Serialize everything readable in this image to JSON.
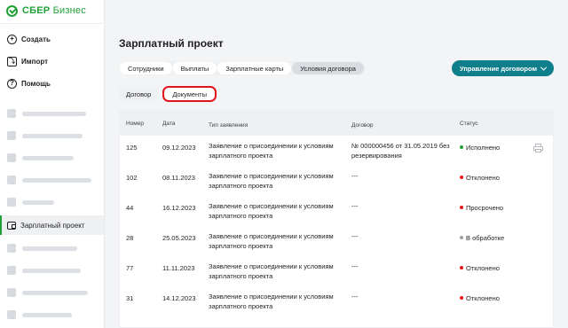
{
  "logo": {
    "brand": "СБЕР",
    "product": "Бизнес"
  },
  "sidebar": {
    "main_items": [
      {
        "label": "Создать",
        "icon": "plus-circle-icon"
      },
      {
        "label": "Импорт",
        "icon": "import-icon"
      },
      {
        "label": "Помощь",
        "icon": "help-circle-icon"
      }
    ],
    "active_item": {
      "label": "Зарплатный проект",
      "icon": "wallet-icon"
    }
  },
  "page": {
    "title": "Зарплатный проект"
  },
  "tabs": [
    "Сотрудники",
    "Выплаты",
    "Зарплатные карты",
    "Условия договора"
  ],
  "active_tab": "Условия договора",
  "manage_button": {
    "label": "Управление договором"
  },
  "subtabs": [
    "Договор",
    "Документы"
  ],
  "active_subtab": "Документы",
  "table": {
    "columns": [
      "Номер",
      "Дата",
      "Тип заявления",
      "Договор",
      "Статус"
    ],
    "rows": [
      {
        "number": "125",
        "date": "09.12.2023",
        "type": "Заявление о присоединении к условиям зарплатного проекта",
        "contract": "№ 000000456 от 31.05.2019 без резервирования",
        "status": "Исполнено",
        "status_color": "#21a038",
        "printable": true
      },
      {
        "number": "102",
        "date": "08.11.2023",
        "type": "Заявление о присоединении к условиям зарплатного проекта",
        "contract": "---",
        "status": "Отклонено",
        "status_color": "#e3131b",
        "printable": false
      },
      {
        "number": "44",
        "date": "16.12.2023",
        "type": "Заявление о присоединении к условиям зарплатного проекта",
        "contract": "---",
        "status": "Просрочено",
        "status_color": "#e3131b",
        "printable": false
      },
      {
        "number": "28",
        "date": "25.05.2023",
        "type": "Заявление о присоединении к условиям зарплатного проекта",
        "contract": "---",
        "status": "В обработке",
        "status_color": "#9aa0a6",
        "printable": false
      },
      {
        "number": "77",
        "date": "11.11.2023",
        "type": "Заявление о присоединении к условиям зарплатного проекта",
        "contract": "---",
        "status": "Отклонено",
        "status_color": "#e3131b",
        "printable": false
      },
      {
        "number": "31",
        "date": "14.12.2023",
        "type": "Заявление о присоединении к условиям зарплатного проекта",
        "contract": "---",
        "status": "Отклонено",
        "status_color": "#e3131b",
        "printable": false
      }
    ]
  },
  "colors": {
    "brand_green": "#21a038",
    "accent_teal": "#107f8c",
    "highlight_red": "#e3131b"
  }
}
